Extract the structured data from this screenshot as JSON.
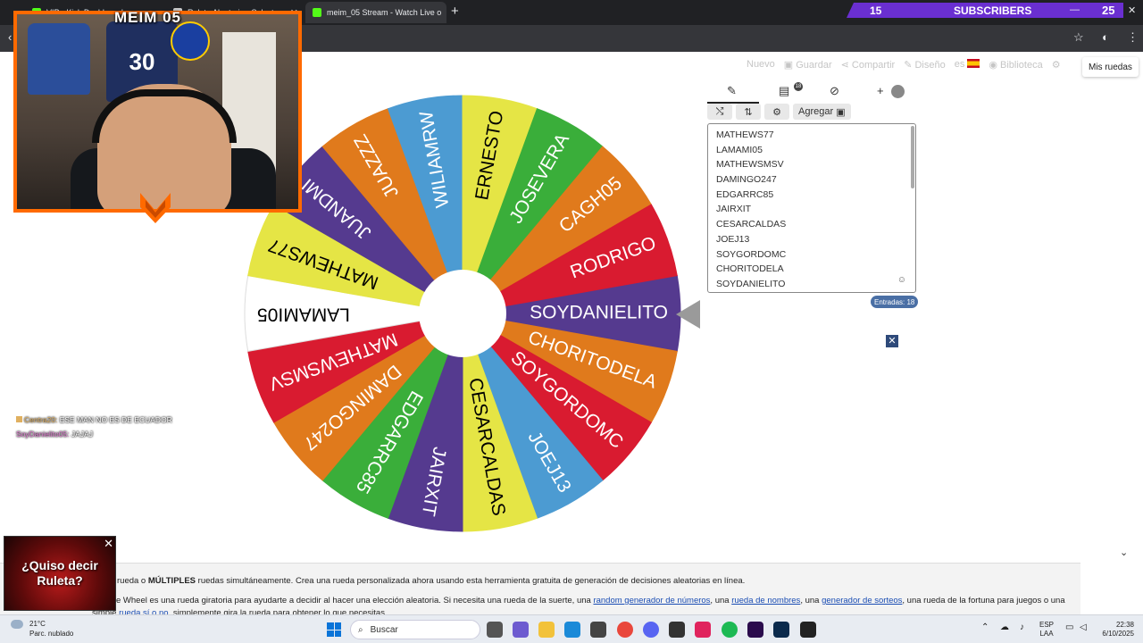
{
  "browser": {
    "tabs": [
      {
        "label": "VIP - Kick Dashboard",
        "active": false
      },
      {
        "label": "Ruleta Aleatoria - Selector",
        "active": false
      },
      {
        "label": "meim_05 Stream - Watch Live o",
        "active": true
      }
    ],
    "new_tab": "+",
    "subs_count": "15",
    "subs_label": "SUBSCRIBERS",
    "subs_number2": "25",
    "win_min": "—",
    "win_max": "◻",
    "win_close": "✕"
  },
  "stream": {
    "title": "MEIM 05",
    "jersey_text": "30"
  },
  "menu": {
    "nuevo": "Nuevo",
    "guardar": "Guardar",
    "compartir": "Compartir",
    "diseno": "Diseño",
    "lang": "es",
    "biblioteca": "Biblioteca",
    "mis_ruedas": "Mis ruedas"
  },
  "wheel": {
    "colors": {
      "yellow": "#e5e545",
      "green": "#3aae3a",
      "orange": "#e07a1c",
      "red": "#d91b30",
      "purple": "#553a8f",
      "blue": "#4c9bd2",
      "white": "#ffffff"
    },
    "segments": [
      {
        "name": "SOYDANIELITO",
        "color": "#553a8f"
      },
      {
        "name": "CHORITODELA",
        "color": "#e07a1c"
      },
      {
        "name": "SOYGORDOMC",
        "color": "#d91b30"
      },
      {
        "name": "JOEJ13",
        "color": "#4c9bd2"
      },
      {
        "name": "CESARCALDAS",
        "color": "#e5e545"
      },
      {
        "name": "JAIRXIT",
        "color": "#553a8f"
      },
      {
        "name": "EDGARRC85",
        "color": "#3aae3a"
      },
      {
        "name": "DAMINGO247",
        "color": "#e07a1c"
      },
      {
        "name": "MATHEWSMSV",
        "color": "#d91b30"
      },
      {
        "name": "LAMAMI05",
        "color": "#ffffff"
      },
      {
        "name": "MATHEWS77",
        "color": "#e5e545"
      },
      {
        "name": "JUANDMI",
        "color": "#553a8f"
      },
      {
        "name": "JUAZZZ",
        "color": "#e07a1c"
      },
      {
        "name": "WILIAMRW",
        "color": "#4c9bd2"
      },
      {
        "name": "ERNESTO",
        "color": "#e5e545"
      },
      {
        "name": "JOSEVERA",
        "color": "#3aae3a"
      },
      {
        "name": "CAGH05",
        "color": "#e07a1c"
      },
      {
        "name": "RODRIGO",
        "color": "#d91b30"
      }
    ]
  },
  "panel": {
    "tab_edit": "✎",
    "tab_results": "▤",
    "results_badge": "18",
    "tab_hide": "⊘",
    "tab_add": "+",
    "btn_shuffle": "⤭",
    "btn_sort": "⇅",
    "btn_settings": "⚙",
    "btn_add": "Agregar",
    "entries": [
      "MATHEWS77",
      "LAMAMI05",
      "MATHEWSMSV",
      "DAMINGO247",
      "EDGARRC85",
      "JAIRXIT",
      "CESARCALDAS",
      "JOEJ13",
      "SOYGORDOMC",
      "CHORITODELA",
      "SOYDANIELITO"
    ],
    "emoji": "☺",
    "entries_count": "Entradas: 18",
    "close": "✕"
  },
  "chat": {
    "line1_user": "Centra20:",
    "line1_msg": "ESE MAN NO ES DE ECUADOR",
    "line2_user": "SoyDanielito05:",
    "line2_msg": "JAJAJ"
  },
  "description": {
    "line1_a": "rueda o ",
    "line1_b": "MÚLTIPLES",
    "line1_c": " ruedas simultáneamente. Crea una rueda personalizada ahora usando esta herramienta gratuita de generación de decisiones aleatorias en línea.",
    "line2_a": "e Wheel es una rueda giratoria para ayudarte a decidir al hacer una elección aleatoria. Si necesita una rueda de la suerte, una ",
    "link1": "random generador de números",
    "line2_b": ", una ",
    "link2": "rueda de nombres",
    "line2_c": ", una ",
    "link3": "generador de sorteos",
    "line2_d": ", una rueda de la fortuna para juegos o una",
    "line3_a": "simple ",
    "link4": "rueda sí o no",
    "line3_b": ", simplemente gira la rueda para obtener lo que necesitas.",
    "chevron": "⌄"
  },
  "ad": {
    "text_line1": "¿Quiso decir",
    "text_line2": "Ruleta?",
    "close": "✕"
  },
  "taskbar": {
    "temp": "21°C",
    "weather": "Parc. nublado",
    "search": "Buscar",
    "lang1": "ESP",
    "lang2": "LAA",
    "time": "22:38",
    "date": "6/10/2025"
  }
}
